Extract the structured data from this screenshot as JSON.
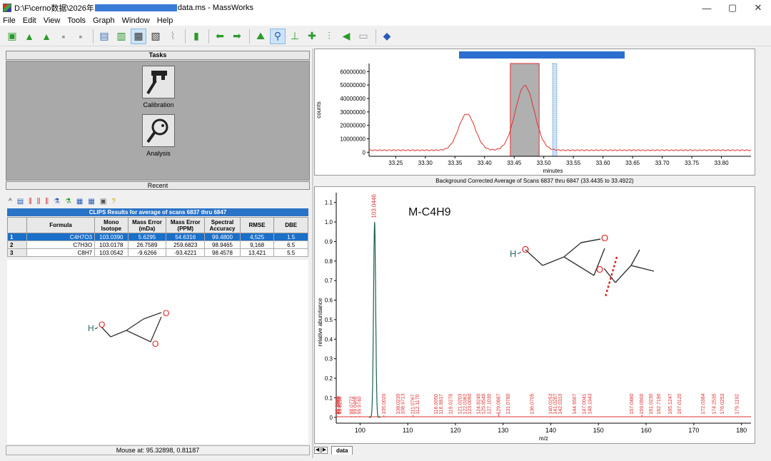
{
  "window": {
    "path_prefix": "D:\\F\\cerno数据\\2026年",
    "path_suffix": "data.ms - MassWorks",
    "min": "—",
    "max": "▢",
    "close": "✕"
  },
  "menu": [
    "File",
    "Edit",
    "View",
    "Tools",
    "Graph",
    "Window",
    "Help"
  ],
  "tasks": {
    "header": "Tasks",
    "calibration": "Calibration",
    "analysis": "Analysis",
    "recent": "Recent"
  },
  "clips": {
    "title": "CLIPS Results for average of scans 6837 thru 6847",
    "headers": [
      "",
      "Formula",
      "Mono Isotope",
      "Mass Error (mDa)",
      "Mass Error (PPM)",
      "Spectral Accuracy",
      "RMSE",
      "DBE"
    ],
    "rows": [
      [
        "1",
        "C4H7O3",
        "103.0390",
        "5.6295",
        "54.6316",
        "99.4800",
        "4,525",
        "1.5"
      ],
      [
        "2",
        "C7H3O",
        "103.0178",
        "26.7589",
        "259.6823",
        "98.9465",
        "9,168",
        "6.5"
      ],
      [
        "3",
        "C8H7",
        "103.0542",
        "-9.6266",
        "-93.4221",
        "98.4578",
        "13,421",
        "5.5"
      ]
    ]
  },
  "mouse_status": "Mouse at: 95.32898, 0.81187",
  "spectrum_title": "Background Corrected Average of Scans 6837 thru 6847 (33.4435 to 33.4922)",
  "annotation": "M-C4H9",
  "mol_labels": {
    "h": "H",
    "o": "O"
  },
  "tab_label": "data",
  "colors": {
    "trace": "#e03030",
    "accent_blue": "#2a6fcf",
    "selection_gray": "#b0b0b0"
  },
  "chart_data": [
    {
      "type": "line",
      "ylabel": "counts",
      "xlabel": "minutes",
      "xlim": [
        33.205,
        33.85
      ],
      "ylim": [
        -3000000,
        66000000
      ],
      "x_ticks": [
        33.25,
        33.3,
        33.35,
        33.4,
        33.45,
        33.5,
        33.55,
        33.6,
        33.65,
        33.7,
        33.75,
        33.8
      ],
      "x_tick_labels": [
        "33.25",
        "33.30",
        "33.35",
        "33.40",
        "33.45",
        "33.50",
        "33.55",
        "33.60",
        "33.65",
        "33.70",
        "33.75",
        "33.80"
      ],
      "y_ticks": [
        0,
        10000000,
        20000000,
        30000000,
        40000000,
        50000000,
        60000000
      ],
      "y_tick_labels": [
        "0",
        "10000000",
        "20000000",
        "30000000",
        "40000000",
        "50000000",
        "60000000"
      ],
      "peaks": [
        {
          "rt": 33.37,
          "height": 27000000,
          "width": 0.014
        },
        {
          "rt": 33.468,
          "height": 48000000,
          "width": 0.016
        }
      ],
      "baseline": 1500000,
      "selection": [
        33.4435,
        33.4922
      ],
      "background_marker": [
        33.515,
        33.522
      ]
    },
    {
      "type": "bar",
      "ylabel": "relative abundance",
      "xlabel": "m/z",
      "xlim": [
        95,
        182
      ],
      "ylim": [
        -0.03,
        1.15
      ],
      "x_ticks": [
        100,
        110,
        120,
        130,
        140,
        150,
        160,
        170,
        180
      ],
      "x_tick_labels": [
        "100",
        "110",
        "120",
        "130",
        "140",
        "150",
        "160",
        "170",
        "180"
      ],
      "y_ticks": [
        0,
        0.1,
        0.2,
        0.3,
        0.4,
        0.5,
        0.6,
        0.7,
        0.8,
        0.9,
        1.0,
        1.1
      ],
      "y_tick_labels": [
        "0",
        "0.1",
        "0.2",
        "0.3",
        "0.4",
        "0.5",
        "0.6",
        "0.7",
        "0.8",
        "0.9",
        "1.0",
        "1.1"
      ],
      "base_peak": {
        "mz": 103.0446,
        "label": "103.0446"
      },
      "peaks": [
        {
          "mz": 95.2,
          "h": 0.004,
          "label": "95.2040"
        },
        {
          "mz": 95.4,
          "h": 0.004,
          "label": "95.3899"
        },
        {
          "mz": 95.6,
          "h": 0.004,
          "label": "95.6000"
        },
        {
          "mz": 95.8,
          "h": 0.004,
          "label": "95.8250"
        },
        {
          "mz": 98.2,
          "h": 0.006,
          "label": "98.0772"
        },
        {
          "mz": 99.0,
          "h": 0.006,
          "label": "99.0468"
        },
        {
          "mz": 99.9,
          "h": 0.006,
          "label": "99.9740"
        },
        {
          "mz": 105.0,
          "h": 0.01,
          "label": "105.0020"
        },
        {
          "mz": 108.0,
          "h": 0.005,
          "label": "108.0230"
        },
        {
          "mz": 109.0,
          "h": 0.005,
          "label": "108.9713"
        },
        {
          "mz": 111.1,
          "h": 0.012,
          "label": "111.0767"
        },
        {
          "mz": 112.1,
          "h": 0.005,
          "label": "112.1170"
        },
        {
          "mz": 116.0,
          "h": 0.005,
          "label": "116.0050"
        },
        {
          "mz": 117.0,
          "h": 0.005,
          "label": "116.9817"
        },
        {
          "mz": 119.0,
          "h": 0.005,
          "label": "119.0278"
        },
        {
          "mz": 121.0,
          "h": 0.005,
          "label": "121.0203"
        },
        {
          "mz": 122.0,
          "h": 0.005,
          "label": "122.0362"
        },
        {
          "mz": 123.0,
          "h": 0.005,
          "label": "123.0090"
        },
        {
          "mz": 124.9,
          "h": 0.005,
          "label": "124.8240"
        },
        {
          "mz": 125.9,
          "h": 0.005,
          "label": "125.8549"
        },
        {
          "mz": 127.1,
          "h": 0.005,
          "label": "127.1030"
        },
        {
          "mz": 129.1,
          "h": 0.02,
          "label": "129.0887"
        },
        {
          "mz": 131.1,
          "h": 0.005,
          "label": "131.0780"
        },
        {
          "mz": 136.1,
          "h": 0.005,
          "label": "136.0705"
        },
        {
          "mz": 140.0,
          "h": 0.005,
          "label": "140.0253"
        },
        {
          "mz": 141.0,
          "h": 0.005,
          "label": "141.0267"
        },
        {
          "mz": 142.0,
          "h": 0.005,
          "label": "142.0310"
        },
        {
          "mz": 145.0,
          "h": 0.005,
          "label": "144.9507"
        },
        {
          "mz": 147.0,
          "h": 0.005,
          "label": "147.0041"
        },
        {
          "mz": 148.2,
          "h": 0.005,
          "label": "148.1943"
        },
        {
          "mz": 157.0,
          "h": 0.005,
          "label": "157.0480"
        },
        {
          "mz": 159.1,
          "h": 0.014,
          "label": "159.0900"
        },
        {
          "mz": 161.0,
          "h": 0.005,
          "label": "161.0230"
        },
        {
          "mz": 162.7,
          "h": 0.005,
          "label": "162.7190"
        },
        {
          "mz": 165.1,
          "h": 0.005,
          "label": "165.1247"
        },
        {
          "mz": 167.0,
          "h": 0.005,
          "label": "167.0120"
        },
        {
          "mz": 172.0,
          "h": 0.005,
          "label": "172.0384"
        },
        {
          "mz": 174.3,
          "h": 0.005,
          "label": "174.2535"
        },
        {
          "mz": 176.0,
          "h": 0.005,
          "label": "176.0253"
        },
        {
          "mz": 179.1,
          "h": 0.005,
          "label": "179.1192"
        }
      ]
    }
  ]
}
